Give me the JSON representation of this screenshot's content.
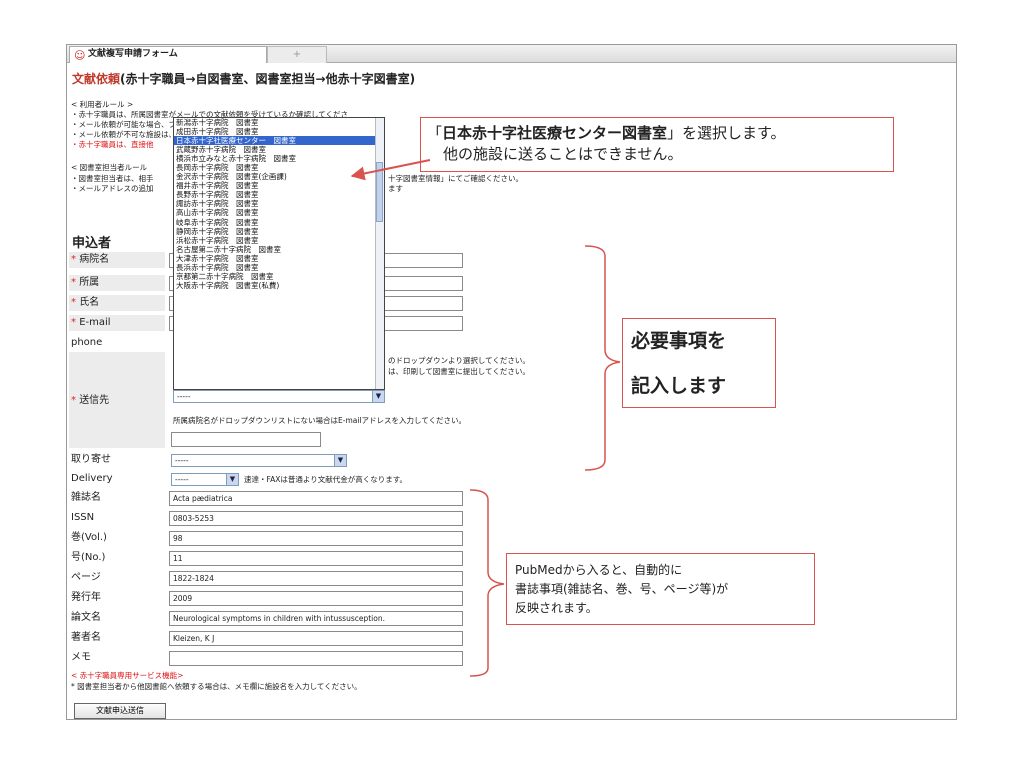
{
  "tab": {
    "title": "文献複写申請フォーム",
    "new_tab": "+"
  },
  "page_title": {
    "red": "文献依頼",
    "rest": "(赤十字職員→自図書室、図書室担当→他赤十字図書室)"
  },
  "rules_user": {
    "heading": "< 利用者ルール >",
    "line1": "・赤十字職員は、所属図書室がメールでの文献依頼を受けているか確認してくださ",
    "line2": "・メール依頼が可能な場合、プルダウンにて所属病院名を選択して送信ボタンを押",
    "line3": "・メール依頼が不可な施設は、この画面を印刷して、図書室に提出ください。",
    "line4": "・赤十字職員は、直接他"
  },
  "rules_staff": {
    "heading": "< 図書室担当者ルール",
    "line1": "・図書室担当者は、相手",
    "line1_tail": "十字図書室情報」にてご確認ください。",
    "line2": "・メールアドレスの追加",
    "line2_tail": "ます"
  },
  "applicant_heading": "申込者",
  "fields": {
    "hospital": {
      "label": "病院名",
      "value": ""
    },
    "department": {
      "label": "所属",
      "value": ""
    },
    "name": {
      "label": "氏名",
      "value": ""
    },
    "email": {
      "label": "E-mail",
      "value": ""
    },
    "phone": {
      "label": "phone",
      "value": ""
    },
    "destination": {
      "label": "送信先",
      "selected": "-----"
    },
    "retrieval": {
      "label": "取り寄せ",
      "selected": "-----"
    },
    "delivery": {
      "label": "Delivery",
      "selected": "-----",
      "note": "速達・FAXは普通より文献代金が高くなります。"
    },
    "journal": {
      "label": "雑誌名",
      "value": "Acta pædiatrica"
    },
    "issn": {
      "label": "ISSN",
      "value": "0803-5253"
    },
    "volume": {
      "label": "巻(Vol.)",
      "value": "98"
    },
    "issue": {
      "label": "号(No.)",
      "value": "11"
    },
    "pages": {
      "label": "ページ",
      "value": "1822-1824"
    },
    "year": {
      "label": "発行年",
      "value": "2009"
    },
    "title": {
      "label": "論文名",
      "value": "Neurological symptoms in children with intussusception."
    },
    "author": {
      "label": "著者名",
      "value": "Kleizen, K J"
    },
    "memo": {
      "label": "メモ",
      "value": ""
    }
  },
  "phone_notes": {
    "line1": "のドロップダウンより選択してください。",
    "line2": "は、印刷して図書室に提出してください。"
  },
  "destination_note": "所属病院名がドロップダウンリストにない場合はE-mailアドレスを入力してください。",
  "dropdown": {
    "items": [
      "新潟赤十字病院　図書室",
      "成田赤十字病院　図書室",
      "日本赤十字社医療センター　図書室",
      "武蔵野赤十字病院　図書室",
      "横浜市立みなと赤十字病院　図書室",
      "長岡赤十字病院　図書室",
      "金沢赤十字病院　図書室(企画課)",
      "福井赤十字病院　図書室",
      "長野赤十字病院　図書室",
      "諏訪赤十字病院　図書室",
      "高山赤十字病院　図書室",
      "岐阜赤十字病院　図書室",
      "静岡赤十字病院　図書室",
      "浜松赤十字病院　図書室",
      "名古屋第二赤十字病院　図書室",
      "大津赤十字病院　図書室",
      "長浜赤十字病院　図書室",
      "京都第二赤十字病院　図書室",
      "大阪赤十字病院　図書室(私費)"
    ],
    "selected_index": 2
  },
  "footer": {
    "red_note": "< 赤十字職員専用サービス機能>",
    "note": "* 図書室担当者から他図書館へ依頼する場合は、メモ欄に施設名を入力してください。",
    "submit_label": "文献申込送信"
  },
  "callouts": {
    "top_line1_pre": "「",
    "top_line1_bold": "日本赤十字社医療センター図書室",
    "top_line1_post": "」を選択します。",
    "top_line2": "他の施設に送ることはできません。",
    "mid_line1": "必要事項を",
    "mid_line2": "記入します",
    "bottom_line1": "PubMedから入ると、自動的に",
    "bottom_line2": "書誌事項(雑誌名、巻、号、ページ等)が",
    "bottom_line3": "反映されます。"
  },
  "colors": {
    "accent_red": "#c0392b",
    "annotation_red": "#d9534f",
    "selection_blue": "#3366cc"
  }
}
